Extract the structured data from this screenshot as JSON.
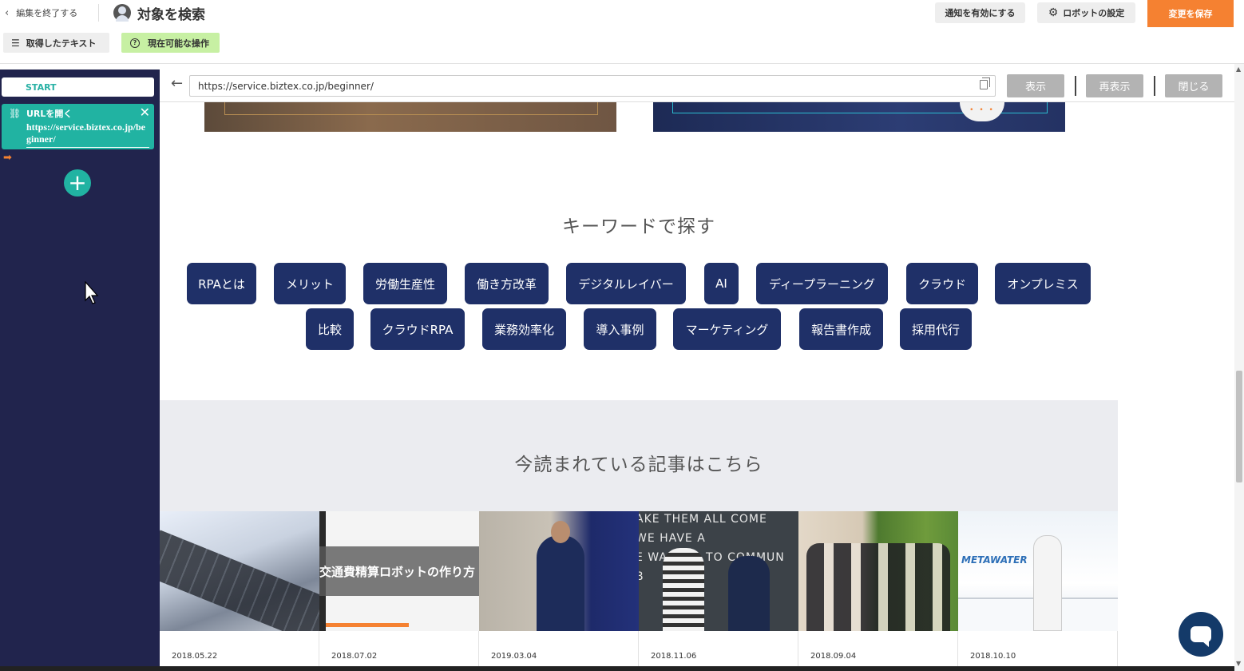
{
  "toolbar": {
    "exit_label": "編集を終了する",
    "mode_title": "対象を検索",
    "notify_label": "通知を有効にする",
    "settings_label": "ロボットの設定",
    "save_label": "変更を保存",
    "text_label": "取得したテキスト",
    "ops_label": "現在可能な操作"
  },
  "sidebar": {
    "start_label": "START",
    "step": {
      "title": "URLを開く",
      "url": "https://service.biztex.co.jp/beginner/"
    },
    "add_symbol": "+"
  },
  "browser": {
    "url": "https://service.biztex.co.jp/beginner/",
    "buttons": {
      "show": "表示",
      "reload": "再表示",
      "close": "閉じる"
    }
  },
  "page": {
    "keyword_heading": "キーワードで探す",
    "keywords": [
      "RPAとは",
      "メリット",
      "労働生産性",
      "働き方改革",
      "デジタルレイバー",
      "AI",
      "ディープラーニング",
      "クラウド",
      "オンプレミス",
      "比較",
      "クラウドRPA",
      "業務効率化",
      "導入事例",
      "マーケティング",
      "報告書作成",
      "採用代行"
    ],
    "articles_heading": "今読まれている記事はこちら",
    "articles": [
      {
        "date": "2018.05.22"
      },
      {
        "date": "2018.07.02",
        "overlay": "交通費精算ロボットの作り方"
      },
      {
        "date": "2019.03.04"
      },
      {
        "date": "2018.11.06",
        "photo_text": "AKE THEM ALL COME\nWE HAVE A\nE WANTED TO COMMUN\nB      ONC\n      PA"
      },
      {
        "date": "2018.09.04"
      },
      {
        "date": "2018.10.10",
        "logo": "METAWATER"
      }
    ]
  },
  "colors": {
    "accent_orange": "#f58131",
    "teal": "#21b3a2",
    "sidebar_navy": "#21244d",
    "tag_navy": "#1f3068",
    "ops_green": "#c7f0a3"
  }
}
